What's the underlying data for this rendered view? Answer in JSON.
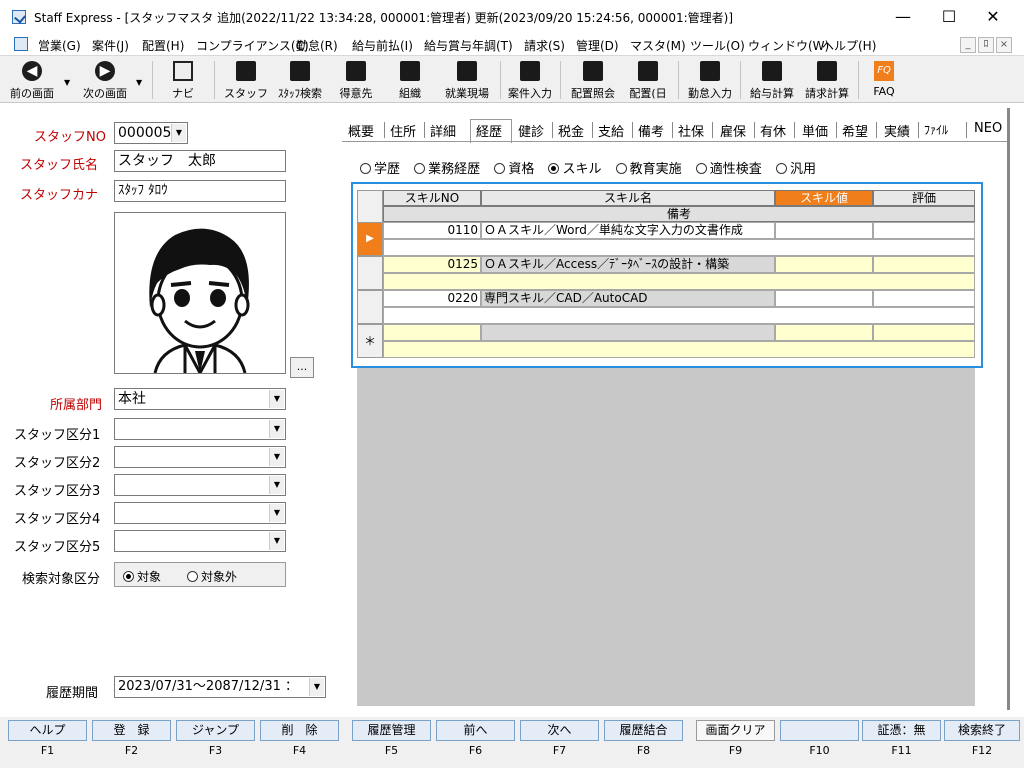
{
  "window": {
    "title": "Staff Express - [スタッフマスタ 追加(2022/11/22 13:34:28, 000001:管理者) 更新(2023/09/20 15:24:56, 000001:管理者)]",
    "minimize": "—",
    "maximize": "☐",
    "close": "✕"
  },
  "menu": {
    "items": [
      "営業(G)",
      "案件(J)",
      "配置(H)",
      "コンプライアンス(C)",
      "勤怠(R)",
      "給与前払(I)",
      "給与賞与年調(T)",
      "請求(S)",
      "管理(D)",
      "マスタ(M)",
      "ツール(O)",
      "ウィンドウ(W)",
      "ヘルプ(H)"
    ],
    "mdi": [
      "_",
      "ﾛ",
      "×"
    ]
  },
  "toolbar": {
    "buttons": [
      "前の画面",
      "次の画面",
      "ナビ",
      "スタッフ",
      "ｽﾀｯﾌ検索",
      "得意先",
      "組織",
      "就業現場",
      "案件入力",
      "配置照会",
      "配置(日",
      "勤怠入力",
      "給与計算",
      "請求計算",
      "FAQ"
    ]
  },
  "staff": {
    "no_label": "スタッフNO",
    "no_value": "000005",
    "name_label": "スタッフ氏名",
    "name_value": "スタッフ　太郎",
    "kana_label": "スタッフカナ",
    "kana_value": "ｽﾀｯﾌ ﾀﾛｳ",
    "browse": "...",
    "dept_label": "所属部門",
    "dept_value": "本社",
    "class_labels": [
      "スタッフ区分1",
      "スタッフ区分2",
      "スタッフ区分3",
      "スタッフ区分4",
      "スタッフ区分5"
    ],
    "search_label": "検索対象区分",
    "search_on": "対象",
    "search_off": "対象外",
    "period_label": "履歴期間",
    "period_value": "2023/07/31～2087/12/31 ："
  },
  "tabs": [
    "概要",
    "住所",
    "詳細",
    "経歴",
    "健診",
    "税金",
    "支給",
    "備考",
    "社保",
    "雇保",
    "有休",
    "単価",
    "希望",
    "実績",
    "ﾌｧｲﾙ",
    "NEO"
  ],
  "active_tab": "経歴",
  "radios": [
    "学歴",
    "業務経歴",
    "資格",
    "スキル",
    "教育実施",
    "適性検査",
    "汎用"
  ],
  "selected_radio": "スキル",
  "grid": {
    "headers": {
      "no": "スキルNO",
      "name": "スキル名",
      "value": "スキル値",
      "eval": "評価",
      "remarks": "備考"
    },
    "rows": [
      {
        "no": "0110",
        "name": "ＯＡスキル／Word／単純な文字入力の文書作成",
        "value": "",
        "eval": ""
      },
      {
        "no": "0125",
        "name": "ＯＡスキル／Access／ﾃﾞｰﾀﾍﾞｰｽの設計・構築",
        "value": "",
        "eval": ""
      },
      {
        "no": "0220",
        "name": "専門スキル／CAD／AutoCAD",
        "value": "",
        "eval": ""
      }
    ],
    "new_row_marker": "＊",
    "current_marker": "▶"
  },
  "fkeys": [
    {
      "label": "ヘルプ",
      "key": "F1"
    },
    {
      "label": "登　録",
      "key": "F2"
    },
    {
      "label": "ジャンプ",
      "key": "F3"
    },
    {
      "label": "削　除",
      "key": "F4"
    },
    {
      "label": "履歴管理",
      "key": "F5"
    },
    {
      "label": "前へ",
      "key": "F6"
    },
    {
      "label": "次へ",
      "key": "F7"
    },
    {
      "label": "履歴結合",
      "key": "F8"
    },
    {
      "label": "画面クリア",
      "key": "F9"
    },
    {
      "label": "",
      "key": "F10"
    },
    {
      "label": "証憑：無",
      "key": "F11"
    },
    {
      "label": "検索終了",
      "key": "F12"
    }
  ],
  "colors": {
    "accent": "#2b8fe0",
    "required_label": "#c00000",
    "orange_header": "#f07e1a",
    "row_yellow": "#ffffcf"
  }
}
